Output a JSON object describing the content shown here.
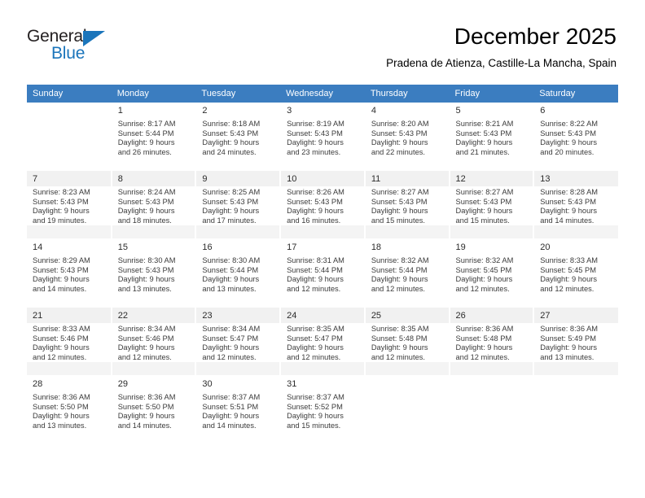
{
  "logo": {
    "word_one": "General",
    "word_two": "Blue",
    "triangle_color": "#1b75bb",
    "text_color": "#231f20"
  },
  "header": {
    "title": "December 2025",
    "subtitle": "Pradena de Atienza, Castille-La Mancha, Spain"
  },
  "colors": {
    "header_row_bg": "#3b7dc0",
    "header_row_text": "#ffffff",
    "shaded_row_bg": "#f1f1f1",
    "page_bg": "#ffffff"
  },
  "weekdays": [
    "Sunday",
    "Monday",
    "Tuesday",
    "Wednesday",
    "Thursday",
    "Friday",
    "Saturday"
  ],
  "weeks": [
    {
      "shaded": false,
      "days": [
        {
          "num": "",
          "sunrise": "",
          "sunset": "",
          "daylight_line1": "",
          "daylight_line2": ""
        },
        {
          "num": "1",
          "sunrise": "Sunrise: 8:17 AM",
          "sunset": "Sunset: 5:44 PM",
          "daylight_line1": "Daylight: 9 hours",
          "daylight_line2": "and 26 minutes."
        },
        {
          "num": "2",
          "sunrise": "Sunrise: 8:18 AM",
          "sunset": "Sunset: 5:43 PM",
          "daylight_line1": "Daylight: 9 hours",
          "daylight_line2": "and 24 minutes."
        },
        {
          "num": "3",
          "sunrise": "Sunrise: 8:19 AM",
          "sunset": "Sunset: 5:43 PM",
          "daylight_line1": "Daylight: 9 hours",
          "daylight_line2": "and 23 minutes."
        },
        {
          "num": "4",
          "sunrise": "Sunrise: 8:20 AM",
          "sunset": "Sunset: 5:43 PM",
          "daylight_line1": "Daylight: 9 hours",
          "daylight_line2": "and 22 minutes."
        },
        {
          "num": "5",
          "sunrise": "Sunrise: 8:21 AM",
          "sunset": "Sunset: 5:43 PM",
          "daylight_line1": "Daylight: 9 hours",
          "daylight_line2": "and 21 minutes."
        },
        {
          "num": "6",
          "sunrise": "Sunrise: 8:22 AM",
          "sunset": "Sunset: 5:43 PM",
          "daylight_line1": "Daylight: 9 hours",
          "daylight_line2": "and 20 minutes."
        }
      ]
    },
    {
      "shaded": true,
      "days": [
        {
          "num": "7",
          "sunrise": "Sunrise: 8:23 AM",
          "sunset": "Sunset: 5:43 PM",
          "daylight_line1": "Daylight: 9 hours",
          "daylight_line2": "and 19 minutes."
        },
        {
          "num": "8",
          "sunrise": "Sunrise: 8:24 AM",
          "sunset": "Sunset: 5:43 PM",
          "daylight_line1": "Daylight: 9 hours",
          "daylight_line2": "and 18 minutes."
        },
        {
          "num": "9",
          "sunrise": "Sunrise: 8:25 AM",
          "sunset": "Sunset: 5:43 PM",
          "daylight_line1": "Daylight: 9 hours",
          "daylight_line2": "and 17 minutes."
        },
        {
          "num": "10",
          "sunrise": "Sunrise: 8:26 AM",
          "sunset": "Sunset: 5:43 PM",
          "daylight_line1": "Daylight: 9 hours",
          "daylight_line2": "and 16 minutes."
        },
        {
          "num": "11",
          "sunrise": "Sunrise: 8:27 AM",
          "sunset": "Sunset: 5:43 PM",
          "daylight_line1": "Daylight: 9 hours",
          "daylight_line2": "and 15 minutes."
        },
        {
          "num": "12",
          "sunrise": "Sunrise: 8:27 AM",
          "sunset": "Sunset: 5:43 PM",
          "daylight_line1": "Daylight: 9 hours",
          "daylight_line2": "and 15 minutes."
        },
        {
          "num": "13",
          "sunrise": "Sunrise: 8:28 AM",
          "sunset": "Sunset: 5:43 PM",
          "daylight_line1": "Daylight: 9 hours",
          "daylight_line2": "and 14 minutes."
        }
      ]
    },
    {
      "shaded": false,
      "days": [
        {
          "num": "14",
          "sunrise": "Sunrise: 8:29 AM",
          "sunset": "Sunset: 5:43 PM",
          "daylight_line1": "Daylight: 9 hours",
          "daylight_line2": "and 14 minutes."
        },
        {
          "num": "15",
          "sunrise": "Sunrise: 8:30 AM",
          "sunset": "Sunset: 5:43 PM",
          "daylight_line1": "Daylight: 9 hours",
          "daylight_line2": "and 13 minutes."
        },
        {
          "num": "16",
          "sunrise": "Sunrise: 8:30 AM",
          "sunset": "Sunset: 5:44 PM",
          "daylight_line1": "Daylight: 9 hours",
          "daylight_line2": "and 13 minutes."
        },
        {
          "num": "17",
          "sunrise": "Sunrise: 8:31 AM",
          "sunset": "Sunset: 5:44 PM",
          "daylight_line1": "Daylight: 9 hours",
          "daylight_line2": "and 12 minutes."
        },
        {
          "num": "18",
          "sunrise": "Sunrise: 8:32 AM",
          "sunset": "Sunset: 5:44 PM",
          "daylight_line1": "Daylight: 9 hours",
          "daylight_line2": "and 12 minutes."
        },
        {
          "num": "19",
          "sunrise": "Sunrise: 8:32 AM",
          "sunset": "Sunset: 5:45 PM",
          "daylight_line1": "Daylight: 9 hours",
          "daylight_line2": "and 12 minutes."
        },
        {
          "num": "20",
          "sunrise": "Sunrise: 8:33 AM",
          "sunset": "Sunset: 5:45 PM",
          "daylight_line1": "Daylight: 9 hours",
          "daylight_line2": "and 12 minutes."
        }
      ]
    },
    {
      "shaded": true,
      "days": [
        {
          "num": "21",
          "sunrise": "Sunrise: 8:33 AM",
          "sunset": "Sunset: 5:46 PM",
          "daylight_line1": "Daylight: 9 hours",
          "daylight_line2": "and 12 minutes."
        },
        {
          "num": "22",
          "sunrise": "Sunrise: 8:34 AM",
          "sunset": "Sunset: 5:46 PM",
          "daylight_line1": "Daylight: 9 hours",
          "daylight_line2": "and 12 minutes."
        },
        {
          "num": "23",
          "sunrise": "Sunrise: 8:34 AM",
          "sunset": "Sunset: 5:47 PM",
          "daylight_line1": "Daylight: 9 hours",
          "daylight_line2": "and 12 minutes."
        },
        {
          "num": "24",
          "sunrise": "Sunrise: 8:35 AM",
          "sunset": "Sunset: 5:47 PM",
          "daylight_line1": "Daylight: 9 hours",
          "daylight_line2": "and 12 minutes."
        },
        {
          "num": "25",
          "sunrise": "Sunrise: 8:35 AM",
          "sunset": "Sunset: 5:48 PM",
          "daylight_line1": "Daylight: 9 hours",
          "daylight_line2": "and 12 minutes."
        },
        {
          "num": "26",
          "sunrise": "Sunrise: 8:36 AM",
          "sunset": "Sunset: 5:48 PM",
          "daylight_line1": "Daylight: 9 hours",
          "daylight_line2": "and 12 minutes."
        },
        {
          "num": "27",
          "sunrise": "Sunrise: 8:36 AM",
          "sunset": "Sunset: 5:49 PM",
          "daylight_line1": "Daylight: 9 hours",
          "daylight_line2": "and 13 minutes."
        }
      ]
    },
    {
      "shaded": false,
      "days": [
        {
          "num": "28",
          "sunrise": "Sunrise: 8:36 AM",
          "sunset": "Sunset: 5:50 PM",
          "daylight_line1": "Daylight: 9 hours",
          "daylight_line2": "and 13 minutes."
        },
        {
          "num": "29",
          "sunrise": "Sunrise: 8:36 AM",
          "sunset": "Sunset: 5:50 PM",
          "daylight_line1": "Daylight: 9 hours",
          "daylight_line2": "and 14 minutes."
        },
        {
          "num": "30",
          "sunrise": "Sunrise: 8:37 AM",
          "sunset": "Sunset: 5:51 PM",
          "daylight_line1": "Daylight: 9 hours",
          "daylight_line2": "and 14 minutes."
        },
        {
          "num": "31",
          "sunrise": "Sunrise: 8:37 AM",
          "sunset": "Sunset: 5:52 PM",
          "daylight_line1": "Daylight: 9 hours",
          "daylight_line2": "and 15 minutes."
        },
        {
          "num": "",
          "sunrise": "",
          "sunset": "",
          "daylight_line1": "",
          "daylight_line2": ""
        },
        {
          "num": "",
          "sunrise": "",
          "sunset": "",
          "daylight_line1": "",
          "daylight_line2": ""
        },
        {
          "num": "",
          "sunrise": "",
          "sunset": "",
          "daylight_line1": "",
          "daylight_line2": ""
        }
      ]
    }
  ]
}
